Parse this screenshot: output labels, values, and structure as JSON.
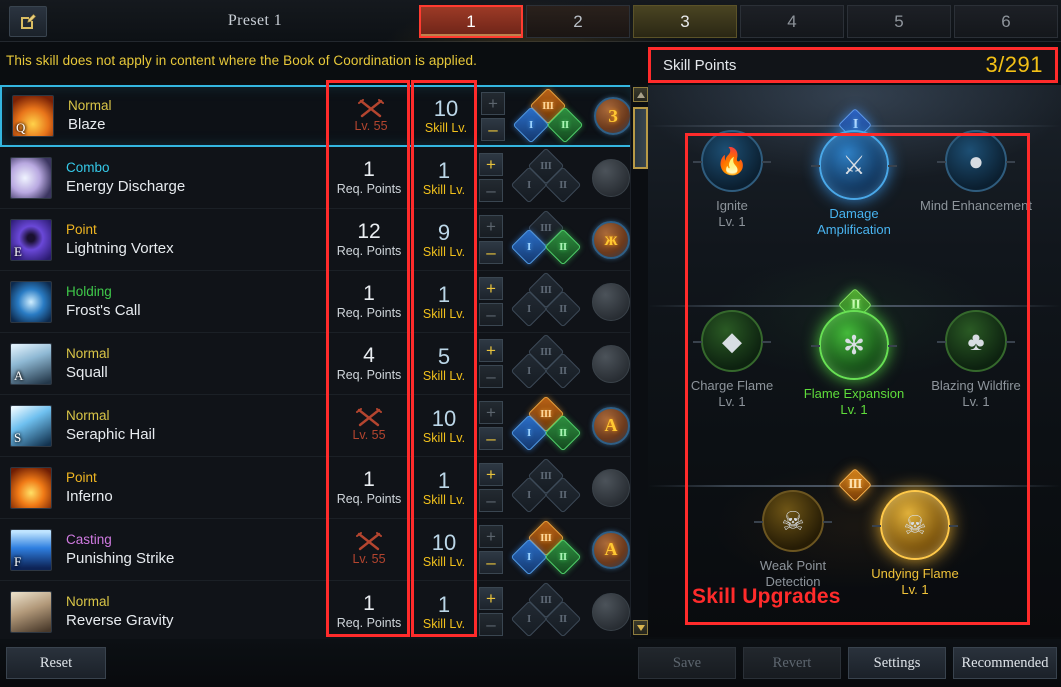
{
  "topbar": {
    "edit_icon": "edit-pencil-icon",
    "preset_name": "Preset 1",
    "tabs": [
      {
        "label": "1",
        "state": "active"
      },
      {
        "label": "2",
        "state": "t2"
      },
      {
        "label": "3",
        "state": "t3"
      },
      {
        "label": "4",
        "state": "dim"
      },
      {
        "label": "5",
        "state": "dim"
      },
      {
        "label": "6",
        "state": "dim"
      }
    ]
  },
  "warning": "This skill does not apply in content where the Book of Coordination is applied.",
  "skill_points": {
    "label": "Skill Points",
    "value": "3/291"
  },
  "annotations": {
    "skill_upgrades_label": "Skill Upgrades"
  },
  "skills": [
    {
      "key": "Q",
      "type": "Normal",
      "type_color": "#d9c547",
      "name": "Blaze",
      "selected": true,
      "locked": true,
      "req_value": "",
      "req_label": "Lv. 55",
      "lv_value": "10",
      "lv_label": "Skill Lv.",
      "plus": "+",
      "minus": "–",
      "plus_state": "off",
      "minus_state": "gold",
      "tripod": {
        "I": "on",
        "II": "on",
        "III": "on"
      },
      "rune": "filled",
      "rune_glyph": "З",
      "icon_css": "radial-gradient(circle at 50% 70%, #ffd24a, #e8741a 45%, #7a2206 85%)"
    },
    {
      "key": "",
      "type": "Combo",
      "type_color": "#35c9e8",
      "name": "Energy Discharge",
      "selected": false,
      "locked": false,
      "req_value": "1",
      "req_label": "Req. Points",
      "lv_value": "1",
      "lv_label": "Skill Lv.",
      "plus": "+",
      "minus": "–",
      "plus_state": "gold",
      "minus_state": "off",
      "tripod": {
        "I": "off",
        "II": "off",
        "III": "off"
      },
      "rune": "empty",
      "rune_glyph": "",
      "icon_css": "radial-gradient(circle at 35% 50%, #f0f4ff, #b8a8e0 45%, #3b3560 85%)"
    },
    {
      "key": "E",
      "type": "Point",
      "type_color": "#f0b622",
      "name": "Lightning Vortex",
      "selected": false,
      "locked": false,
      "req_value": "12",
      "req_label": "Req. Points",
      "lv_value": "9",
      "lv_label": "Skill Lv.",
      "plus": "+",
      "minus": "–",
      "plus_state": "off",
      "minus_state": "gold",
      "tripod": {
        "I": "on",
        "II": "on",
        "III": "off"
      },
      "rune": "filled",
      "rune_glyph": "ж",
      "icon_css": "radial-gradient(circle at 50% 45%, #1a1030 12%, #6a48d8 40%, #2a1a70 90%)"
    },
    {
      "key": "",
      "type": "Holding",
      "type_color": "#3fc94a",
      "name": "Frost's Call",
      "selected": false,
      "locked": false,
      "req_value": "1",
      "req_label": "Req. Points",
      "lv_value": "1",
      "lv_label": "Skill Lv.",
      "plus": "+",
      "minus": "–",
      "plus_state": "gold",
      "minus_state": "off",
      "tripod": {
        "I": "off",
        "II": "off",
        "III": "off"
      },
      "rune": "empty",
      "rune_glyph": "",
      "icon_css": "radial-gradient(circle at 50% 50%, #cfeeff, #2a7cc4 45%, #0d2a4d 90%)"
    },
    {
      "key": "A",
      "type": "Normal",
      "type_color": "#d9c547",
      "name": "Squall",
      "selected": false,
      "locked": false,
      "req_value": "4",
      "req_label": "Req. Points",
      "lv_value": "5",
      "lv_label": "Skill Lv.",
      "plus": "+",
      "minus": "–",
      "plus_state": "gold",
      "minus_state": "off",
      "tripod": {
        "I": "off",
        "II": "off",
        "III": "off"
      },
      "rune": "empty",
      "rune_glyph": "",
      "icon_css": "linear-gradient(160deg, #dff0fb 5%, #8fb9d4 40%, #24384a 95%)"
    },
    {
      "key": "S",
      "type": "Normal",
      "type_color": "#d9c547",
      "name": "Seraphic Hail",
      "selected": false,
      "locked": true,
      "req_value": "",
      "req_label": "Lv. 55",
      "lv_value": "10",
      "lv_label": "Skill Lv.",
      "plus": "+",
      "minus": "–",
      "plus_state": "off",
      "minus_state": "gold",
      "tripod": {
        "I": "on",
        "II": "on",
        "III": "on"
      },
      "rune": "filled",
      "rune_glyph": "А",
      "icon_css": "linear-gradient(150deg, #eaf8ff 5%, #6fc0ef 40%, #12324f 95%)"
    },
    {
      "key": "",
      "type": "Point",
      "type_color": "#f0b622",
      "name": "Inferno",
      "selected": false,
      "locked": false,
      "req_value": "1",
      "req_label": "Req. Points",
      "lv_value": "1",
      "lv_label": "Skill Lv.",
      "plus": "+",
      "minus": "–",
      "plus_state": "gold",
      "minus_state": "off",
      "tripod": {
        "I": "off",
        "II": "off",
        "III": "off"
      },
      "rune": "empty",
      "rune_glyph": "",
      "icon_css": "radial-gradient(circle at 50% 62%, #ffe066, #f07a16 40%, #6e1d04 88%)"
    },
    {
      "key": "F",
      "type": "Casting",
      "type_color": "#cf7ae0",
      "name": "Punishing Strike",
      "selected": false,
      "locked": true,
      "req_value": "",
      "req_label": "Lv. 55",
      "lv_value": "10",
      "lv_label": "Skill Lv.",
      "plus": "+",
      "minus": "–",
      "plus_state": "off",
      "minus_state": "gold",
      "tripod": {
        "I": "on",
        "II": "on",
        "III": "on"
      },
      "rune": "filled",
      "rune_glyph": "А",
      "icon_css": "linear-gradient(180deg, #bfe4ff 5%, #2f7fe0 45%, #0d2356 95%)"
    },
    {
      "key": "",
      "type": "Normal",
      "type_color": "#d9c547",
      "name": "Reverse Gravity",
      "selected": false,
      "locked": false,
      "req_value": "1",
      "req_label": "Req. Points",
      "lv_value": "1",
      "lv_label": "Skill Lv.",
      "plus": "+",
      "minus": "–",
      "plus_state": "gold",
      "minus_state": "off",
      "tripod": {
        "I": "off",
        "II": "off",
        "III": "off"
      },
      "rune": "empty",
      "rune_glyph": "",
      "icon_css": "linear-gradient(160deg, #e7dcc5 5%, #b2997a 45%, #4a3a2b 95%)"
    }
  ],
  "scrollbar": {
    "up_icon": "scroll-up-arrow-icon",
    "down_icon": "scroll-down-arrow-icon"
  },
  "tree": {
    "tiers": [
      {
        "numeral": "I",
        "cls": "t1"
      },
      {
        "numeral": "II",
        "cls": "t2"
      },
      {
        "numeral": "III",
        "cls": "t3"
      }
    ],
    "rows": [
      {
        "tier": "I",
        "nodes": [
          {
            "label": "Ignite",
            "lv": "Lv. 1",
            "state": "dim-blue",
            "glyph": "🔥",
            "active": false
          },
          {
            "label": "Damage Amplification",
            "lv": "",
            "state": "blue",
            "glyph": "⚔",
            "active": true
          },
          {
            "label": "Mind Enhancement",
            "lv": "",
            "state": "dim-blue",
            "glyph": "●",
            "active": false
          }
        ]
      },
      {
        "tier": "II",
        "nodes": [
          {
            "label": "Charge Flame",
            "lv": "Lv. 1",
            "state": "dim-green",
            "glyph": "◆",
            "active": false
          },
          {
            "label": "Flame Expansion",
            "lv": "Lv. 1",
            "state": "green",
            "glyph": "✻",
            "active": true
          },
          {
            "label": "Blazing Wildfire",
            "lv": "Lv. 1",
            "state": "dim-green",
            "glyph": "♣",
            "active": false
          }
        ]
      },
      {
        "tier": "III",
        "nodes": [
          {
            "label": "Weak Point Detection",
            "lv": "",
            "state": "dim-gold",
            "glyph": "☠",
            "active": false
          },
          {
            "label": "Undying Flame",
            "lv": "Lv. 1",
            "state": "gold",
            "glyph": "☠",
            "active": true
          }
        ]
      }
    ]
  },
  "bottom": {
    "reset": "Reset",
    "save": "Save",
    "revert": "Revert",
    "settings": "Settings",
    "recommended": "Recommended"
  }
}
